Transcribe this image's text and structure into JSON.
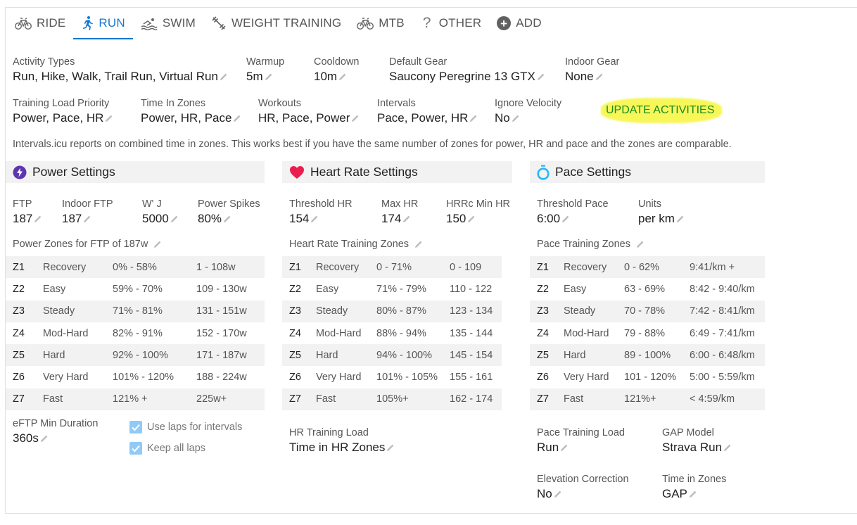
{
  "tabs": [
    {
      "label": "RIDE",
      "icon": "bicycle-icon"
    },
    {
      "label": "RUN",
      "icon": "running-icon",
      "active": true
    },
    {
      "label": "SWIM",
      "icon": "swimmer-icon"
    },
    {
      "label": "WEIGHT TRAINING",
      "icon": "dumbbell-icon"
    },
    {
      "label": "MTB",
      "icon": "bicycle-icon"
    },
    {
      "label": "OTHER",
      "icon": "question-icon"
    },
    {
      "label": "ADD",
      "icon": "add-circle-icon"
    }
  ],
  "general": {
    "activity_types_label": "Activity Types",
    "activity_types": "Run, Hike, Walk, Trail Run, Virtual Run",
    "warmup_label": "Warmup",
    "warmup": "5m",
    "cooldown_label": "Cooldown",
    "cooldown": "10m",
    "default_gear_label": "Default Gear",
    "default_gear": "Saucony Peregrine 13 GTX",
    "indoor_gear_label": "Indoor Gear",
    "indoor_gear": "None",
    "training_load_priority_label": "Training Load Priority",
    "training_load_priority": "Power, Pace, HR",
    "time_in_zones_label": "Time In Zones",
    "time_in_zones": "Power, HR, Pace",
    "workouts_label": "Workouts",
    "workouts": "HR, Pace, Power",
    "intervals_label": "Intervals",
    "intervals": "Pace, Power, HR",
    "ignore_velocity_label": "Ignore Velocity",
    "ignore_velocity": "No",
    "update_activities": "UPDATE ACTIVITIES",
    "note": "Intervals.icu reports on combined time in zones. This works best if you have the same number of zones for power, HR and pace and the zones are comparable."
  },
  "power": {
    "title": "Power Settings",
    "ftp_label": "FTP",
    "ftp": "187",
    "indoor_ftp_label": "Indoor FTP",
    "indoor_ftp": "187",
    "wj_label": "W' J",
    "wj": "5000",
    "power_spikes_label": "Power Spikes",
    "power_spikes": "80%",
    "zones_title": "Power Zones for FTP of 187w",
    "zones": [
      {
        "id": "Z1",
        "name": "Recovery",
        "pct": "0% - 58%",
        "range": "1 - 108w"
      },
      {
        "id": "Z2",
        "name": "Easy",
        "pct": "59% - 70%",
        "range": "109 - 130w"
      },
      {
        "id": "Z3",
        "name": "Steady",
        "pct": "71% - 81%",
        "range": "131 - 151w"
      },
      {
        "id": "Z4",
        "name": "Mod-Hard",
        "pct": "82% - 91%",
        "range": "152 - 170w"
      },
      {
        "id": "Z5",
        "name": "Hard",
        "pct": "92% - 100%",
        "range": "171 - 187w"
      },
      {
        "id": "Z6",
        "name": "Very Hard",
        "pct": "101% - 120%",
        "range": "188 - 224w"
      },
      {
        "id": "Z7",
        "name": "Fast",
        "pct": "121% +",
        "range": "225w+"
      }
    ],
    "eftp_label": "eFTP Min Duration",
    "eftp": "360s",
    "use_laps": "Use laps for intervals",
    "keep_laps": "Keep all laps"
  },
  "hr": {
    "title": "Heart Rate Settings",
    "threshold_label": "Threshold HR",
    "threshold": "154",
    "max_label": "Max HR",
    "max": "174",
    "hrrc_label": "HRRc Min HR",
    "hrrc": "150",
    "zones_title": "Heart Rate Training Zones",
    "zones": [
      {
        "id": "Z1",
        "name": "Recovery",
        "pct": "0 - 71%",
        "range": "0 - 109"
      },
      {
        "id": "Z2",
        "name": "Easy",
        "pct": "71% - 79%",
        "range": "110 - 122"
      },
      {
        "id": "Z3",
        "name": "Steady",
        "pct": "80% - 87%",
        "range": "123 - 134"
      },
      {
        "id": "Z4",
        "name": "Mod-Hard",
        "pct": "88% - 94%",
        "range": "135 - 144"
      },
      {
        "id": "Z5",
        "name": "Hard",
        "pct": "94% - 100%",
        "range": "145 - 154"
      },
      {
        "id": "Z6",
        "name": "Very Hard",
        "pct": "101% - 105%",
        "range": "155 - 161"
      },
      {
        "id": "Z7",
        "name": "Fast",
        "pct": "105%+",
        "range": "162 - 174"
      }
    ],
    "load_label": "HR Training Load",
    "load": "Time in HR Zones"
  },
  "pace": {
    "title": "Pace Settings",
    "threshold_label": "Threshold Pace",
    "threshold": "6:00",
    "units_label": "Units",
    "units": "per km",
    "zones_title": "Pace Training Zones",
    "zones": [
      {
        "id": "Z1",
        "name": "Recovery",
        "pct": "0 - 62%",
        "range": "9:41/km +"
      },
      {
        "id": "Z2",
        "name": "Easy",
        "pct": "63 - 69%",
        "range": "8:42 - 9:40/km"
      },
      {
        "id": "Z3",
        "name": "Steady",
        "pct": "70 - 78%",
        "range": "7:42 - 8:41/km"
      },
      {
        "id": "Z4",
        "name": "Mod-Hard",
        "pct": "79 - 88%",
        "range": "6:49 - 7:41/km"
      },
      {
        "id": "Z5",
        "name": "Hard",
        "pct": "89 - 100%",
        "range": "6:00 - 6:48/km"
      },
      {
        "id": "Z6",
        "name": "Very Hard",
        "pct": "101 - 120%",
        "range": "5:00 - 5:59/km"
      },
      {
        "id": "Z7",
        "name": "Fast",
        "pct": "121%+",
        "range": "< 4:59/km"
      }
    ],
    "load_label": "Pace Training Load",
    "load": "Run",
    "gap_label": "GAP Model",
    "gap": "Strava Run",
    "elev_label": "Elevation Correction",
    "elev": "No",
    "tiz_label": "Time in Zones",
    "tiz": "GAP"
  },
  "colors": {
    "accent": "#1976d2",
    "power_icon": "#5e35b1",
    "heart_icon": "#e91e4f",
    "pace_icon": "#29b6f6",
    "highlight": "#f7f75a",
    "update_text": "#1a8a1a"
  }
}
